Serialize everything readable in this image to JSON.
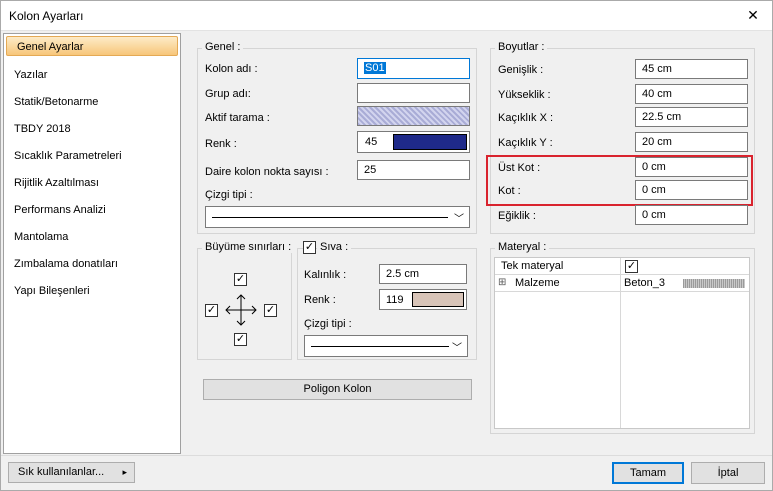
{
  "window": {
    "title": "Kolon Ayarları"
  },
  "nav": {
    "items": [
      {
        "label": "Genel Ayarlar"
      },
      {
        "label": "Yazılar"
      },
      {
        "label": "Statik/Betonarme"
      },
      {
        "label": "TBDY 2018"
      },
      {
        "label": "Sıcaklık Parametreleri"
      },
      {
        "label": "Rijitlik Azaltılması"
      },
      {
        "label": "Performans Analizi"
      },
      {
        "label": "Mantolama"
      },
      {
        "label": "Zımbalama donatıları"
      },
      {
        "label": "Yapı Bileşenleri"
      }
    ]
  },
  "genel": {
    "title": "Genel :",
    "kolon_adi_label": "Kolon adı :",
    "kolon_adi_value": "S01",
    "grup_adi_label": "Grup adı:",
    "grup_adi_value": "",
    "aktif_tarama_label": "Aktif tarama :",
    "renk_label": "Renk :",
    "renk_value": "45",
    "renk_color": "#1f2a8a",
    "daire_label": "Daire kolon nokta sayısı :",
    "daire_value": "25",
    "cizgi_label": "Çizgi tipi :"
  },
  "buyume": {
    "title": "Büyüme sınırları :"
  },
  "siva": {
    "title": "Sıva :",
    "checked": "✓",
    "kalinlik_label": "Kalınlık :",
    "kalinlik_value": "2.5 cm",
    "renk_label": "Renk :",
    "renk_value": "119",
    "renk_color": "#d8c4b8",
    "cizgi_label": "Çizgi tipi :"
  },
  "poligon_button": "Poligon Kolon",
  "boyutlar": {
    "title": "Boyutlar :",
    "rows": [
      {
        "label": "Genişlik :",
        "value": "45 cm"
      },
      {
        "label": "Yükseklik :",
        "value": "40 cm"
      },
      {
        "label": "Kaçıklık X :",
        "value": "22.5 cm"
      },
      {
        "label": "Kaçıklık Y :",
        "value": "20 cm"
      },
      {
        "label": "Üst Kot :",
        "value": "0 cm"
      },
      {
        "label": "Kot :",
        "value": "0 cm"
      },
      {
        "label": "Eğiklik :",
        "value": "0 cm"
      }
    ]
  },
  "materyal": {
    "title": "Materyal :",
    "tek_label": "Tek materyal",
    "tek_checked": "✓",
    "malzeme_label": "Malzeme",
    "malzeme_value": "Beton_3",
    "expand": "⊞"
  },
  "footer": {
    "frequent_label": "Sık kullanılanlar...",
    "frequent_arrow": "▸",
    "ok_label": "Tamam",
    "cancel_label": "İptal"
  }
}
